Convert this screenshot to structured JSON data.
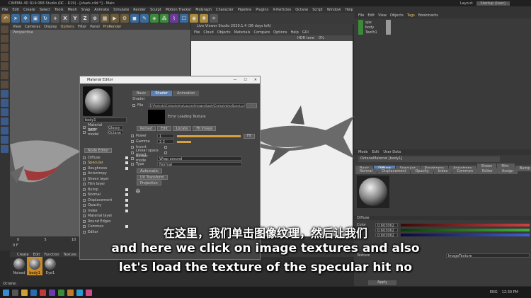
{
  "window": {
    "title": "CINEMA 4D R19.068 Studio (RC - R19) - [shark.c4d *] - Main",
    "layout_label": "Layout:",
    "layout_value": "Startup (User)"
  },
  "menubar": [
    "File",
    "Edit",
    "Create",
    "Select",
    "Tools",
    "Mesh",
    "Snap",
    "Animate",
    "Simulate",
    "Render",
    "Sculpt",
    "Motion Tracker",
    "MoGraph",
    "Character",
    "Pipeline",
    "Plugins",
    "X-Particles",
    "Octane",
    "Script",
    "Window",
    "Help"
  ],
  "toolbar": {
    "xyz": [
      "X",
      "Y",
      "Z"
    ]
  },
  "viewport1": {
    "menu": [
      "View",
      "Cameras",
      "Display",
      "Options",
      "Filter",
      "Panel",
      "ProRender"
    ],
    "label": "Perspective"
  },
  "viewport2": {
    "title": "Live Viewer Studio 2020.1.4 (36 days left)",
    "menu": [
      "File",
      "Cloud",
      "Objects",
      "Materials",
      "Compare",
      "Options",
      "Help",
      "GUI"
    ],
    "hdr": "HDR tone",
    "percent": "0%"
  },
  "objects": {
    "menu": [
      "File",
      "Edit",
      "View",
      "Objects",
      "Tags",
      "Bookmarks"
    ],
    "items": [
      "spe",
      "body",
      "Teeth1"
    ]
  },
  "attributes": {
    "menu": [
      "Mode",
      "Edit",
      "User Data"
    ],
    "material_name": "OctaneMaterial [body1]",
    "tabs1": [
      "Basic",
      "Diffuse",
      "Specular",
      "Roughness",
      "Anisotropy",
      "Sheen layer",
      "Film layer",
      "Bump"
    ],
    "tabs2": [
      "Normal",
      "Displacement",
      "Opacity",
      "Index",
      "Common",
      "Editor",
      "Assign"
    ],
    "section": "Diffuse",
    "rows": [
      {
        "label": "Color",
        "value": "0.603062"
      },
      {
        "label": "",
        "value": "0.603062"
      },
      {
        "label": "",
        "value": "0.603062"
      }
    ],
    "colors": [
      "#d04040",
      "#40b040",
      "#4060d0"
    ],
    "bottom_label": "Texture",
    "bottom_value": "ImageTexture"
  },
  "material_editor": {
    "title": "Material Editor",
    "name": "body1",
    "type_rows": [
      {
        "label": "Material type",
        "value": "Glossy"
      },
      {
        "label": "BRDF model",
        "value": "Octane"
      }
    ],
    "node_editor": "Node Editor",
    "channels": [
      {
        "label": "Diffuse",
        "on": true
      },
      {
        "label": "Specular",
        "on": true
      },
      {
        "label": "Roughness",
        "on": true
      },
      {
        "label": "Anisotropy",
        "on": false
      },
      {
        "label": "Sheen layer",
        "on": false
      },
      {
        "label": "Film layer",
        "on": false
      },
      {
        "label": "Bump",
        "on": true
      },
      {
        "label": "Normal",
        "on": true
      },
      {
        "label": "Displacement",
        "on": true
      },
      {
        "label": "Opacity",
        "on": true
      },
      {
        "label": "Index",
        "on": true
      },
      {
        "label": "Material layer",
        "on": false
      },
      {
        "label": "Round Edges",
        "on": false
      },
      {
        "label": "Common",
        "on": true
      },
      {
        "label": "Editor",
        "on": false
      }
    ],
    "tabs": [
      "Basic",
      "Shader",
      "Animation"
    ],
    "section": "Shader",
    "file_label": "File",
    "file_path": "E:\\Projects\\Cretsolydma\\course\\Images\\body\\CretsolydmaSpeck.png",
    "error": "Error Loading Texture",
    "buttons": [
      "Reload",
      "Edit",
      "Locate",
      "Fit image"
    ],
    "props": [
      {
        "label": "Power",
        "value": "1"
      },
      {
        "label": "Gamma",
        "value": "2.2"
      },
      {
        "label": "Invert",
        "value": ""
      },
      {
        "label": "Linear space invert",
        "value": ""
      },
      {
        "label": "Border mode",
        "value": "Wrap around"
      },
      {
        "label": "Type",
        "value": "Normal"
      }
    ],
    "fit_label": "Fit",
    "extra_buttons": [
      "Automatic",
      "UV Transform",
      "Projection"
    ]
  },
  "timeline": {
    "start": "0 F",
    "marks": [
      "0",
      "5",
      "10",
      "15",
      "20",
      "25",
      "30"
    ]
  },
  "material_manager": {
    "menu": [
      "Create",
      "Edit",
      "Function",
      "Texture"
    ],
    "materials": [
      "Noised",
      "body1",
      "Eye1"
    ]
  },
  "subtitles": {
    "chinese": "在这里，我们单击图像纹理，然后让我们",
    "english1": "and here we click on image textures and also",
    "english2": "let's load the texture of the specular hit no"
  },
  "apply_button": "Apply",
  "statusbar": "Octane:",
  "taskbar": {
    "time": "12:30 PM",
    "lang": "ENG"
  }
}
